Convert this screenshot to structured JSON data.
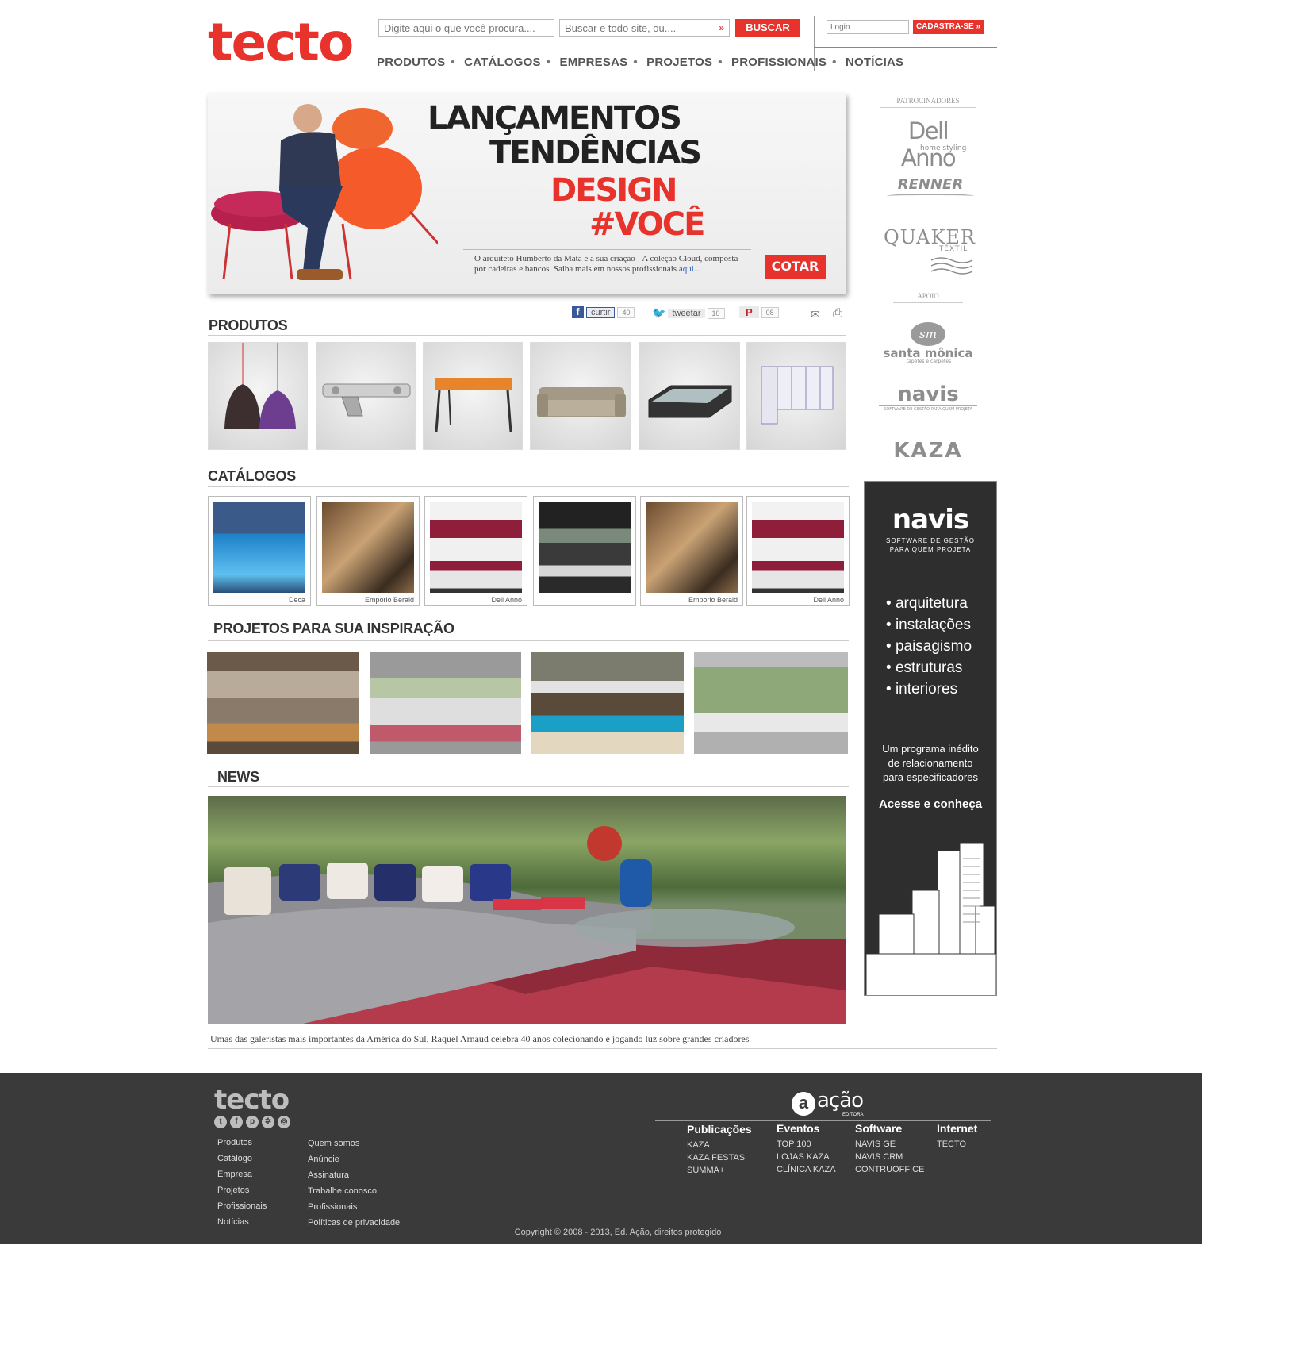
{
  "header": {
    "logo": "tecto",
    "search_placeholder": "Digite aqui o que você procura....",
    "scope_placeholder": "Buscar e todo site, ou....",
    "search_button": "BUSCAR",
    "login_placeholder": "Login",
    "signup_button": "CADASTRA-SE"
  },
  "nav": [
    "PRODUTOS",
    "CATÁLOGOS",
    "EMPRESAS",
    "PROJETOS",
    "PROFISSIONAIS",
    "NOTÍCIAS"
  ],
  "hero": {
    "line1": "LANÇAMENTOS",
    "line2": "TENDÊNCIAS",
    "line3": "DESIGN",
    "line4": "#VOCÊ",
    "caption": "O arquiteto Humberto da Mata  e a sua criação - A coleção Cloud, composta por cadeiras e bancos. Saiba mais em nossos profissionais",
    "caption_link": "aqui...",
    "button": "COTAR"
  },
  "share": {
    "like": "curtir",
    "like_count": "40",
    "tweet": "tweetar",
    "tweet_count": "10",
    "pin_count": "08"
  },
  "sections": {
    "produtos": "PRODUTOS",
    "catalogos": "CATÁLOGOS",
    "projetos": "PROJETOS PARA SUA INSPIRAÇÃO",
    "news": "NEWS"
  },
  "catalogs": [
    {
      "brand": "Deca"
    },
    {
      "brand": "Emporio Berald"
    },
    {
      "brand": "Dell Anno"
    },
    {
      "brand": ""
    },
    {
      "brand": "Emporio Berald"
    },
    {
      "brand": "Dell Anno"
    }
  ],
  "news_caption": "Umas das galeristas mais importantes da América do Sul, Raquel Arnaud celebra 40 anos colecionando e jogando luz sobre grandes criadores",
  "sidebar": {
    "sponsors_label": "PATROCINADORES",
    "sponsors": [
      "Dell Anno",
      "home styling",
      "RENNER",
      "QUAKER",
      "TÊXTIL"
    ],
    "support_label": "APOIO",
    "support": [
      "santa mônica",
      "tapetes e carpetes",
      "navis",
      "SOFTWARE DE GESTÃO PARA QUEM PROJETA",
      "KAZA"
    ]
  },
  "ad": {
    "brand": "navis",
    "tagline1": "SOFTWARE DE GESTÃO",
    "tagline2": "PARA QUEM PROJETA",
    "items": [
      "arquitetura",
      "instalações",
      "paisagismo",
      "estruturas",
      "interiores"
    ],
    "text1": "Um programa inédito",
    "text2": "de relacionamento",
    "text3": "para especificadores",
    "cta": "Acesse e conheça"
  },
  "footer": {
    "logo": "tecto",
    "col1": [
      "Produtos",
      "Catálogo",
      "Empresa",
      "Projetos",
      "Profissionais",
      "Notícias"
    ],
    "col2": [
      "Quem somos",
      "Anúncie",
      "Assinatura",
      "Trabalhe conosco",
      "Profissionais",
      "Políticas de privacidade"
    ],
    "publisher": "ação",
    "publisher_sub": "EDITORA",
    "groups": [
      {
        "title": "Publicações",
        "items": [
          "KAZA",
          "KAZA FESTAS",
          "SUMMA+"
        ]
      },
      {
        "title": "Eventos",
        "items": [
          "TOP 100",
          "LOJAS KAZA",
          "CLÍNICA KAZA"
        ]
      },
      {
        "title": "Software",
        "items": [
          "NAVIS GE",
          "NAVIS CRM",
          "CONTRUOFFICE"
        ]
      },
      {
        "title": "Internet",
        "items": [
          "TECTO"
        ]
      }
    ],
    "copyright": "Copyright © 2008 - 2013, Ed. Ação, direitos protegido"
  },
  "colors": {
    "brand_red": "#e8322c",
    "footer_bg": "#3a3a3a",
    "ad_bg": "#2e2e2e"
  }
}
